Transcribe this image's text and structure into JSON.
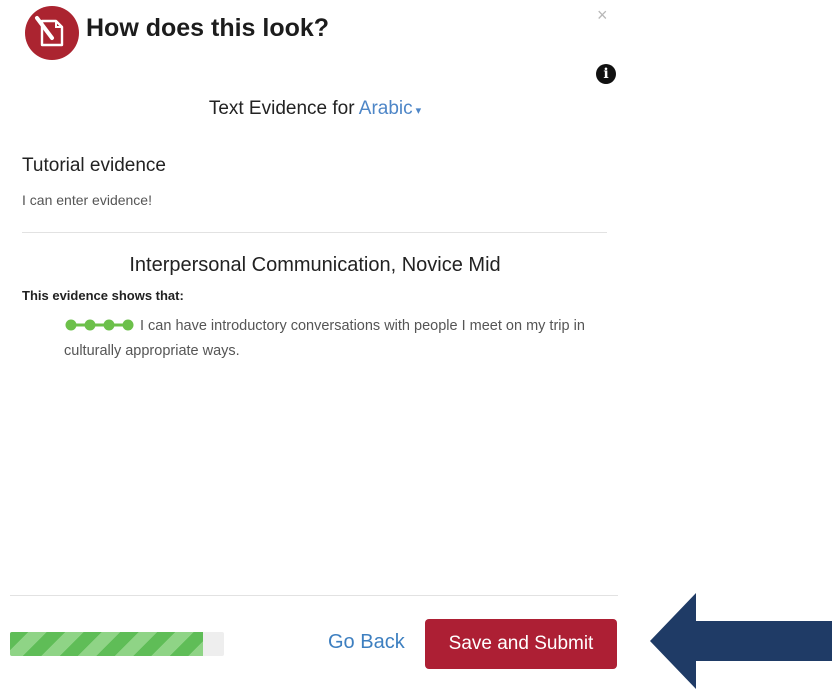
{
  "header": {
    "title": "How does this look?",
    "close_glyph": "×",
    "info_glyph": "i",
    "logo_icon": "document-pencil-icon",
    "logo_color": "#ab2430"
  },
  "evidence_heading": {
    "prefix": "Text Evidence for",
    "language": "Arabic",
    "caret": "▾"
  },
  "evidence": {
    "title": "Tutorial evidence",
    "body": "I can enter evidence!"
  },
  "competency": {
    "title": "Interpersonal Communication, Novice Mid",
    "shows_label": "This evidence shows that:",
    "statement": "I can have introductory conversations with people I meet on my trip in culturally appropriate ways.",
    "level_dots": 4,
    "dot_color": "#6cc04a"
  },
  "footer": {
    "progress": 0.9,
    "go_back_label": "Go Back",
    "submit_label": "Save and Submit",
    "submit_color": "#ad1f34"
  },
  "annotation": {
    "icon": "arrow-left-icon",
    "color": "#1f3b66"
  }
}
